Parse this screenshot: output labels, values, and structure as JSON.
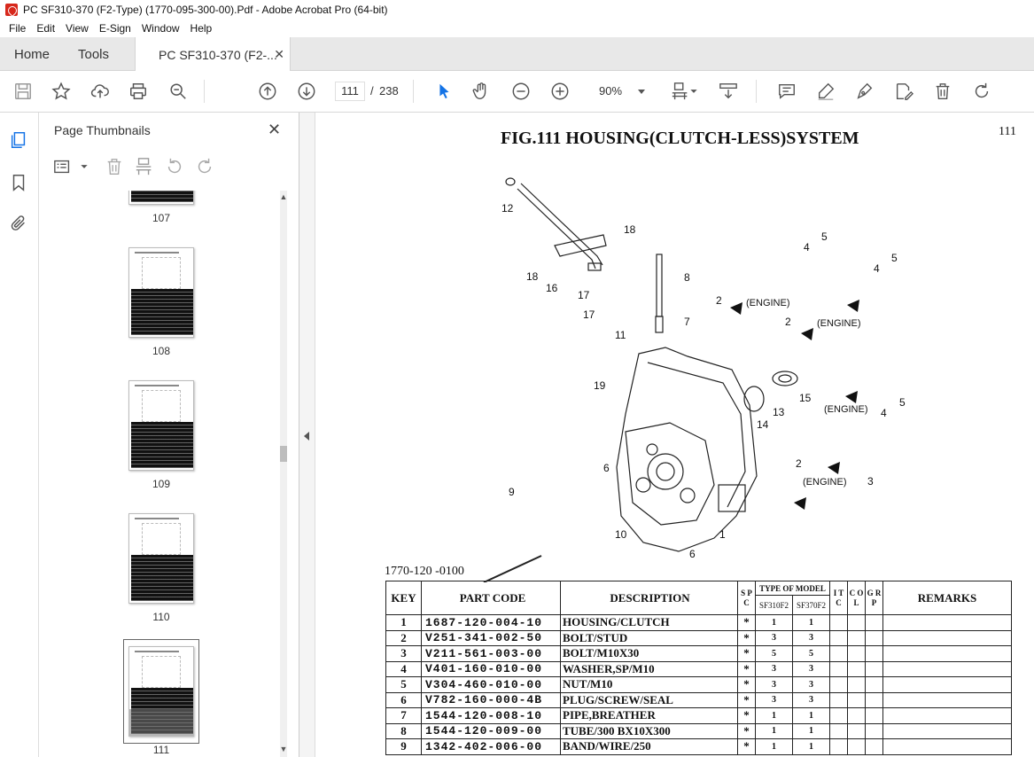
{
  "window": {
    "title": "PC SF310-370 (F2-Type) (1770-095-300-00).Pdf - Adobe Acrobat Pro (64-bit)"
  },
  "menu": [
    "File",
    "Edit",
    "View",
    "E-Sign",
    "Window",
    "Help"
  ],
  "tabs": {
    "home": "Home",
    "tools": "Tools",
    "document": "PC SF310-370 (F2-..."
  },
  "toolbar": {
    "current_page": "111",
    "page_separator": "/",
    "total_pages": "238",
    "zoom": "90%"
  },
  "thumbnails": {
    "title": "Page Thumbnails",
    "pages": [
      "107",
      "108",
      "109",
      "110",
      "111"
    ],
    "selected": "111"
  },
  "document": {
    "figure_title": "FIG.111  HOUSING(CLUTCH-LESS)SYSTEM",
    "page_number": "111",
    "catalog_number": "1770-120 -0100",
    "diagram_labels": [
      "12",
      "18",
      "18",
      "16",
      "17",
      "17",
      "11",
      "8",
      "7",
      "2",
      "2",
      "4",
      "5",
      "4",
      "5",
      "19",
      "13",
      "14",
      "15",
      "4",
      "5",
      "2",
      "6",
      "3",
      "9",
      "1",
      "10",
      "6"
    ],
    "engine_label": "(ENGINE)",
    "table": {
      "headers": {
        "key": "KEY",
        "part_code": "PART CODE",
        "description": "DESCRIPTION",
        "spc": "S P C",
        "type_of_model": "TYPE OF MODEL",
        "model1": "SF310F2",
        "model2": "SF370F2",
        "itc": "I T C",
        "col": "C O L",
        "grp": "G R P",
        "remarks": "REMARKS"
      },
      "rows": [
        {
          "key": "1",
          "code": "1687-120-004-10",
          "desc": "HOUSING/CLUTCH",
          "spc": "*",
          "m1": "1",
          "m2": "1"
        },
        {
          "key": "2",
          "code": "V251-341-002-50",
          "desc": "BOLT/STUD",
          "spc": "*",
          "m1": "3",
          "m2": "3"
        },
        {
          "key": "3",
          "code": "V211-561-003-00",
          "desc": "BOLT/M10X30",
          "spc": "*",
          "m1": "5",
          "m2": "5"
        },
        {
          "key": "4",
          "code": "V401-160-010-00",
          "desc": "WASHER,SP/M10",
          "spc": "*",
          "m1": "3",
          "m2": "3"
        },
        {
          "key": "5",
          "code": "V304-460-010-00",
          "desc": "NUT/M10",
          "spc": "*",
          "m1": "3",
          "m2": "3"
        },
        {
          "key": "6",
          "code": "V782-160-000-4B",
          "desc": "PLUG/SCREW/SEAL",
          "spc": "*",
          "m1": "3",
          "m2": "3"
        },
        {
          "key": "7",
          "code": "1544-120-008-10",
          "desc": "PIPE,BREATHER",
          "spc": "*",
          "m1": "1",
          "m2": "1"
        },
        {
          "key": "8",
          "code": "1544-120-009-00",
          "desc": "TUBE/300 BX10X300",
          "spc": "*",
          "m1": "1",
          "m2": "1"
        },
        {
          "key": "9",
          "code": "1342-402-006-00",
          "desc": "BAND/WIRE/250",
          "spc": "*",
          "m1": "1",
          "m2": "1"
        }
      ]
    }
  }
}
